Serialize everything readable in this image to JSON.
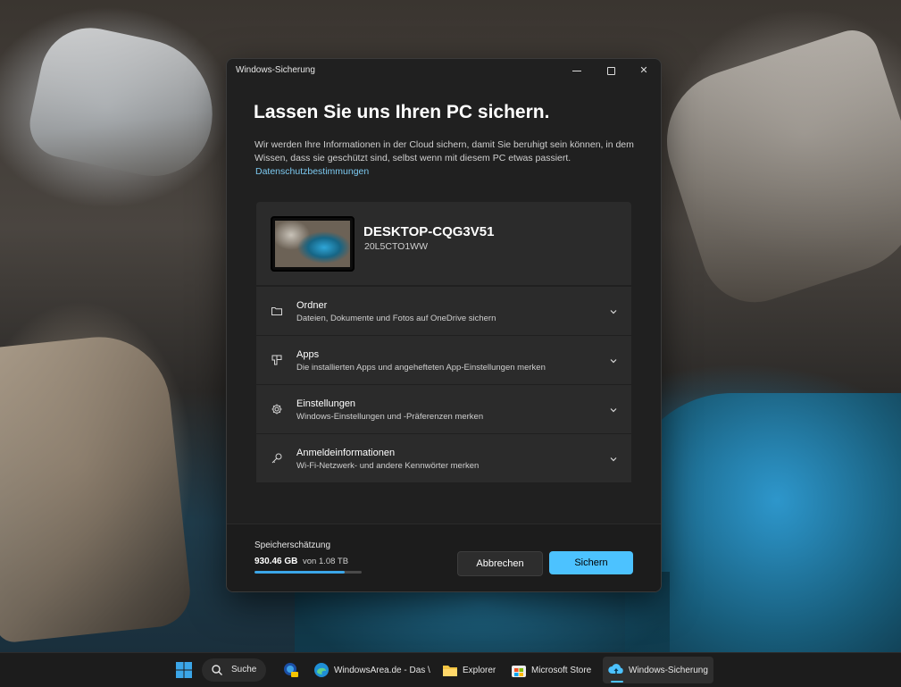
{
  "window": {
    "title": "Windows-Sicherung",
    "controls": {
      "minimize": "minimize",
      "maximize": "maximize",
      "close": "✕"
    }
  },
  "main": {
    "heading": "Lassen Sie uns Ihren PC sichern.",
    "description": "Wir werden Ihre Informationen in der Cloud sichern, damit Sie beruhigt sein können, in dem Wissen, dass sie geschützt sind, selbst wenn mit diesem PC etwas passiert.",
    "privacy_link": "Datenschutzbestimmungen"
  },
  "device": {
    "name": "DESKTOP-CQG3V51",
    "model": "20L5CTO1WW"
  },
  "sections": [
    {
      "icon": "folder-icon",
      "title": "Ordner",
      "subtitle": "Dateien, Dokumente und Fotos auf OneDrive sichern"
    },
    {
      "icon": "apps-icon",
      "title": "Apps",
      "subtitle": "Die installierten Apps und angehefteten App-Einstellungen merken"
    },
    {
      "icon": "gear-icon",
      "title": "Einstellungen",
      "subtitle": "Windows-Einstellungen und -Präferenzen merken"
    },
    {
      "icon": "key-icon",
      "title": "Anmeldeinformationen",
      "subtitle": "Wi-Fi-Netzwerk- und andere Kennwörter merken"
    }
  ],
  "footer": {
    "storage_label": "Speicherschätzung",
    "storage_used": "930.46 GB",
    "storage_total": "von 1.08 TB",
    "storage_fraction": 0.84,
    "cancel_label": "Abbrechen",
    "save_label": "Sichern"
  },
  "taskbar": {
    "search_label": "Suche",
    "apps": [
      {
        "icon": "start-icon",
        "label": ""
      },
      {
        "icon": "photoshop-icon",
        "label": ""
      },
      {
        "icon": "edge-icon",
        "label": "WindowsArea.de - Das \\"
      },
      {
        "icon": "explorer-icon",
        "label": "Explorer"
      },
      {
        "icon": "store-icon",
        "label": "Microsoft Store"
      },
      {
        "icon": "backup-icon",
        "label": "Windows-Sicherung"
      }
    ]
  },
  "colors": {
    "accent": "#4cc2ff",
    "link": "#7cc9f0",
    "window_bg": "#202020",
    "card_bg": "#2b2b2b"
  }
}
